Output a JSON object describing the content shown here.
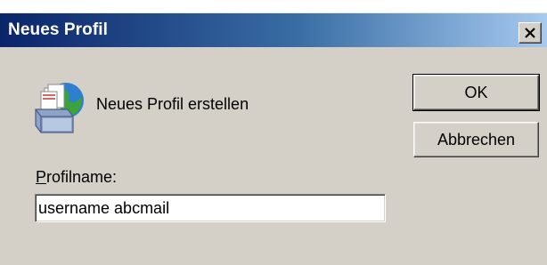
{
  "window": {
    "title": "Neues Profil"
  },
  "dialog": {
    "heading": "Neues Profil erstellen",
    "icon": "mail-profile-icon"
  },
  "buttons": {
    "ok_label": "OK",
    "cancel_label": "Abbrechen"
  },
  "profile_field": {
    "label_accel": "P",
    "label_rest": "rofilname:",
    "value": "username abcmail"
  },
  "colors": {
    "titlebar_start": "#0a246a",
    "titlebar_end": "#a6caf0",
    "dialog_background": "#d4d0c8"
  }
}
